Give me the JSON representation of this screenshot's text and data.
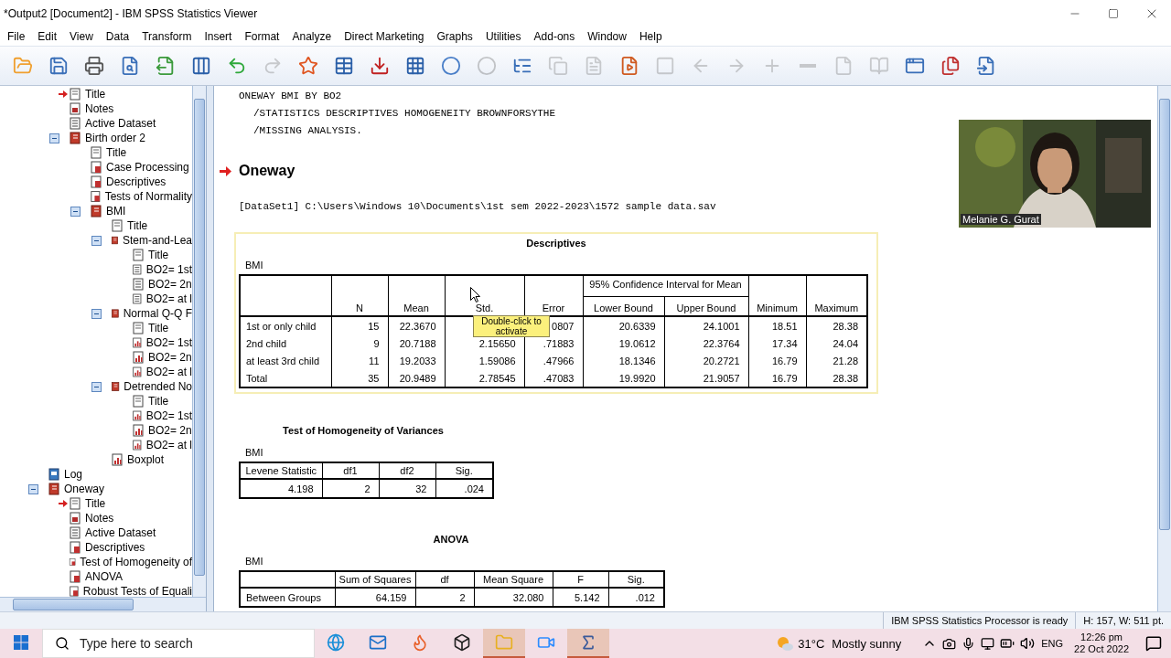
{
  "window": {
    "title": "*Output2 [Document2] - IBM SPSS Statistics Viewer"
  },
  "menu": [
    "File",
    "Edit",
    "View",
    "Data",
    "Transform",
    "Insert",
    "Format",
    "Analyze",
    "Direct Marketing",
    "Graphs",
    "Utilities",
    "Add-ons",
    "Window",
    "Help"
  ],
  "toolbar": [
    {
      "disabled": false
    },
    {
      "disabled": false
    },
    {
      "disabled": false
    },
    {
      "disabled": false
    },
    {
      "disabled": false
    },
    {
      "disabled": false
    },
    {
      "disabled": false
    },
    {
      "disabled": true
    },
    {
      "disabled": false
    },
    {
      "disabled": false
    },
    {
      "disabled": false
    },
    {
      "disabled": false
    },
    {
      "disabled": false
    },
    {
      "disabled": true
    },
    {
      "disabled": false
    },
    {
      "disabled": true
    },
    {
      "disabled": true
    },
    {
      "disabled": false
    },
    {
      "disabled": true
    },
    {
      "disabled": true
    },
    {
      "disabled": true
    },
    {
      "disabled": true
    },
    {
      "disabled": true
    },
    {
      "disabled": true
    },
    {
      "disabled": true
    },
    {
      "disabled": false
    },
    {
      "disabled": false
    },
    {
      "disabled": false
    }
  ],
  "tree": {
    "continued_children": [
      {
        "label": "Title",
        "kind": "title",
        "current": true
      },
      {
        "label": "Notes",
        "kind": "notes",
        "current": false
      },
      {
        "label": "Active Dataset",
        "kind": "text",
        "current": false
      },
      {
        "label": "Birth order 2",
        "kind": "folder",
        "current": false,
        "expanded": true,
        "children": [
          {
            "label": "Title",
            "kind": "title",
            "current": false
          },
          {
            "label": "Case Processing",
            "kind": "table",
            "current": false
          },
          {
            "label": "Descriptives",
            "kind": "table",
            "current": false
          },
          {
            "label": "Tests of Normality",
            "kind": "table",
            "current": false
          },
          {
            "label": "BMI",
            "kind": "folder",
            "current": false,
            "expanded": true,
            "children": [
              {
                "label": "Title",
                "kind": "title",
                "current": false
              },
              {
                "label": "Stem-and-Lea",
                "kind": "folder",
                "current": false,
                "expanded": true,
                "children": [
                  {
                    "label": "Title",
                    "kind": "title",
                    "current": false
                  },
                  {
                    "label": "BO2= 1st",
                    "kind": "text",
                    "current": false
                  },
                  {
                    "label": "BO2= 2n",
                    "kind": "text",
                    "current": false
                  },
                  {
                    "label": "BO2= at l",
                    "kind": "text",
                    "current": false
                  }
                ]
              },
              {
                "label": "Normal Q-Q F",
                "kind": "folder",
                "current": false,
                "expanded": true,
                "children": [
                  {
                    "label": "Title",
                    "kind": "title",
                    "current": false
                  },
                  {
                    "label": "BO2= 1st",
                    "kind": "chart",
                    "current": false
                  },
                  {
                    "label": "BO2= 2n",
                    "kind": "chart",
                    "current": false
                  },
                  {
                    "label": "BO2= at l",
                    "kind": "chart",
                    "current": false
                  }
                ]
              },
              {
                "label": "Detrended No",
                "kind": "folder",
                "current": false,
                "expanded": true,
                "children": [
                  {
                    "label": "Title",
                    "kind": "title",
                    "current": false
                  },
                  {
                    "label": "BO2= 1st",
                    "kind": "chart",
                    "current": false
                  },
                  {
                    "label": "BO2= 2n",
                    "kind": "chart",
                    "current": false
                  },
                  {
                    "label": "BO2= at l",
                    "kind": "chart",
                    "current": false
                  }
                ]
              },
              {
                "label": "Boxplot",
                "kind": "chart",
                "current": false
              }
            ]
          }
        ]
      }
    ],
    "items": [
      {
        "label": "Log",
        "kind": "log",
        "current": false
      },
      {
        "label": "Oneway",
        "kind": "folder",
        "current": false,
        "expanded": true,
        "children": [
          {
            "label": "Title",
            "kind": "title",
            "current": true
          },
          {
            "label": "Notes",
            "kind": "notes",
            "current": false
          },
          {
            "label": "Active Dataset",
            "kind": "text",
            "current": false
          },
          {
            "label": "Descriptives",
            "kind": "table",
            "current": false
          },
          {
            "label": "Test of Homogeneity of",
            "kind": "table",
            "current": false
          },
          {
            "label": "ANOVA",
            "kind": "table",
            "current": false
          },
          {
            "label": "Robust Tests of Equali",
            "kind": "table",
            "current": false
          }
        ]
      }
    ]
  },
  "syntax": [
    {
      "text": "ONEWAY BMI BY BO2",
      "kind": "command"
    },
    {
      "text": "/STATISTICS DESCRIPTIVES HOMOGENEITY BROWNFORSYTHE",
      "kind": "continuation"
    },
    {
      "text": "/MISSING ANALYSIS.",
      "kind": "continuation"
    }
  ],
  "heading": "Oneway",
  "dataset": "[DataSet1] C:\\Users\\Windows 10\\Documents\\1st sem 2022-2023\\1572 sample data.sav",
  "video_overlay": {
    "kind": "picture",
    "caption": "Melanie G. Gurat"
  },
  "descriptives": {
    "title": "Descriptives",
    "variable": "BMI",
    "selected": true,
    "columns": [
      {
        "label": "N"
      },
      {
        "label": "Mean"
      },
      {
        "label": "Std."
      },
      {
        "label": "Error"
      },
      {
        "label": "95% Confidence Interval for Mean",
        "colspan": 2,
        "children": [
          {
            "label": "Lower Bound"
          },
          {
            "label": "Upper Bound"
          }
        ]
      },
      {
        "label": "Minimum"
      },
      {
        "label": "Maximum"
      }
    ],
    "rows": [
      {
        "label": "1st or only child",
        "cells": [
          "15",
          "22.3670",
          null,
          "0807",
          "20.6339",
          "24.1001",
          "18.51",
          "28.38"
        ]
      },
      {
        "label": "2nd child",
        "cells": [
          "9",
          "20.7188",
          "2.15650",
          ".71883",
          "19.0612",
          "22.3764",
          "17.34",
          "24.04"
        ]
      },
      {
        "label": "at least 3rd child",
        "cells": [
          "11",
          "19.2033",
          "1.59086",
          ".47966",
          "18.1346",
          "20.2721",
          "16.79",
          "21.28"
        ]
      },
      {
        "label": "Total",
        "cells": [
          "35",
          "20.9489",
          "2.78545",
          ".47083",
          "19.9920",
          "21.9057",
          "16.79",
          "28.38"
        ]
      }
    ],
    "tooltip": "Double-click to activate"
  },
  "homogeneity": {
    "title": "Test of Homogeneity of Variances",
    "variable": "BMI",
    "columns": [
      "Levene Statistic",
      "df1",
      "df2",
      "Sig."
    ],
    "rows": [
      [
        "4.198",
        "2",
        "32",
        ".024"
      ]
    ]
  },
  "anova": {
    "title": "ANOVA",
    "variable": "BMI",
    "columns": [
      "Sum of Squares",
      "df",
      "Mean Square",
      "F",
      "Sig."
    ],
    "rows": [
      {
        "label": "Between Groups",
        "cells": [
          "64.159",
          "2",
          "32.080",
          "5.142",
          ".012"
        ]
      }
    ]
  },
  "status_bar": [
    "IBM SPSS Statistics Processor is ready",
    "H: 157, W: 511 pt."
  ],
  "taskbar": {
    "search_placeholder": "Type here to search",
    "apps": [
      {
        "active": false
      },
      {
        "active": false
      },
      {
        "active": false
      },
      {
        "active": false
      },
      {
        "active": true
      },
      {
        "active": false
      },
      {
        "active": true
      }
    ],
    "temperature": "31°C",
    "weather": "Mostly sunny",
    "language": "ENG",
    "time": "12:26 pm",
    "date": "22 Oct 2022"
  }
}
